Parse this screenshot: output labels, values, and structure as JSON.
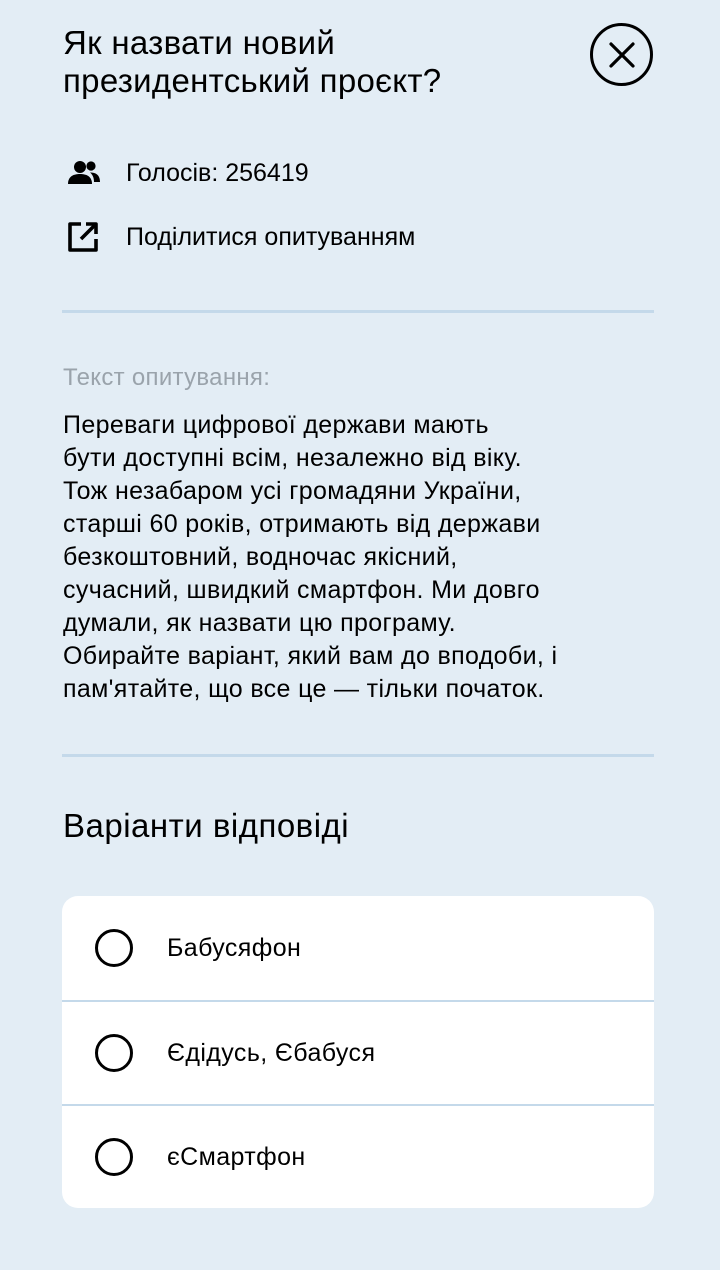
{
  "modal": {
    "title": "Як назвати новий президентський проєкт?",
    "votes_label": "Голосів: 256419",
    "share_label": "Поділитися опитуванням",
    "poll_text_label": "Текст опитування:",
    "poll_text_lines": [
      "Переваги цифрової держави мають",
      "бути доступні всім, незалежно від віку.",
      "Тож незабаром усі громадяни України,",
      "старші 60 років, отримають від держави",
      "безкоштовний, водночас якісний,",
      "сучасний, швидкий смартфон. Ми довго",
      "думали, як назвати цю програму.",
      "Обирайте варіант, який вам до вподоби, і",
      "пам'ятайте, що все це — тільки початок."
    ],
    "answers_heading": "Варіанти відповіді",
    "options": [
      {
        "label": "Бабусяфон",
        "selected": false
      },
      {
        "label": "Єдідусь, Єбабуся",
        "selected": false
      },
      {
        "label": "єСмартфон",
        "selected": false
      }
    ]
  },
  "icons": {
    "close": "close-icon",
    "votes": "people-icon",
    "share": "external-link-icon"
  },
  "colors": {
    "background": "#e3edf5",
    "divider": "#c4d9ea",
    "muted_text": "#9aa3ab",
    "card": "#ffffff"
  }
}
